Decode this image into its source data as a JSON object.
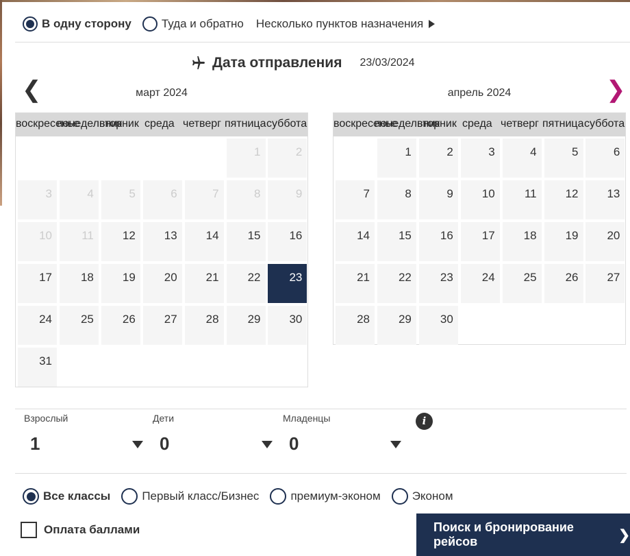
{
  "trip_type": {
    "options": [
      {
        "label": "В одну сторону",
        "selected": true
      },
      {
        "label": "Туда и обратно",
        "selected": false
      }
    ],
    "multi_city_label": "Несколько пунктов назначения"
  },
  "departure": {
    "title": "Дата отправления",
    "date": "23/03/2024"
  },
  "nav": {
    "prev": "❮",
    "next": "❯"
  },
  "calendars": [
    {
      "month": "март 2024",
      "weekdays": [
        "воскресенье",
        "понедельник",
        "вторник",
        "среда",
        "четверг",
        "пятница",
        "суббота"
      ],
      "first_weekday": 5,
      "days": 31,
      "disabled_until": 11,
      "selected_day": 23
    },
    {
      "month": "апрель 2024",
      "weekdays": [
        "воскресенье",
        "понедельник",
        "вторник",
        "среда",
        "четверг",
        "пятница",
        "суббота"
      ],
      "first_weekday": 1,
      "days": 30,
      "disabled_until": 0,
      "selected_day": null
    }
  ],
  "passengers": {
    "adults": {
      "label": "Взрослый",
      "value": "1"
    },
    "children": {
      "label": "Дети",
      "value": "0"
    },
    "infants": {
      "label": "Младенцы",
      "value": "0"
    },
    "info_icon": "i"
  },
  "cabin_class": {
    "options": [
      {
        "label": "Все классы",
        "selected": true
      },
      {
        "label": "Первый класс/Бизнес",
        "selected": false
      },
      {
        "label": "премиум-эконом",
        "selected": false
      },
      {
        "label": "Эконом",
        "selected": false
      }
    ]
  },
  "pay_with_points": {
    "label": "Оплата баллами",
    "checked": false
  },
  "search_button": {
    "label": "Поиск и бронирование рейсов",
    "chevron": "❯"
  },
  "colors": {
    "accent": "#1e3050",
    "next_arrow": "#b21874"
  }
}
